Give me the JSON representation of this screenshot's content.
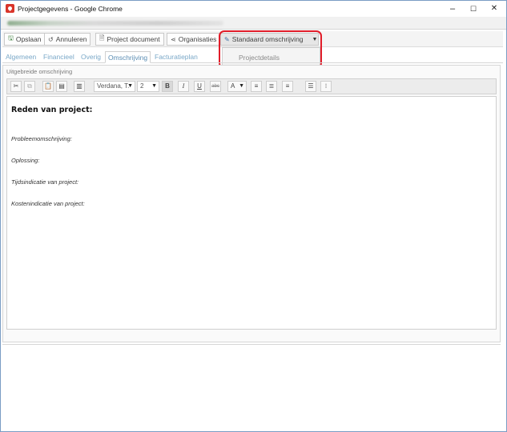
{
  "window": {
    "title": "Projectgegevens - Google Chrome",
    "controls": {
      "minimize": "–",
      "maximize": "☐",
      "close": "✕"
    }
  },
  "toolbar": {
    "save": "Opslaan",
    "cancel": "Annuleren",
    "project_document": "Project document",
    "organisations": "Organisaties",
    "standard_description": "Standaard omschrijving"
  },
  "dropdown": {
    "items": [
      "Projectdetails"
    ]
  },
  "tabs": [
    "Algemeen",
    "Financieel",
    "Overig",
    "Omschrijving",
    "Facturatieplan"
  ],
  "active_tab": "Omschrijving",
  "panel": {
    "caption": "Uitgebreide omschrijving",
    "font": "Verdana, T.",
    "size": "2",
    "format_buttons": {
      "bold": "B",
      "italic": "I",
      "underline": "U",
      "strike": "abc",
      "font_color": "A"
    }
  },
  "editor": {
    "heading": "Reden van project:",
    "lines": [
      "Probleemomschrijving:",
      "Oplossing:",
      "Tijdsindicatie van project:",
      "Kostenindicatie van project:"
    ]
  },
  "colors": {
    "highlight": "#e11d2a",
    "tab_text": "#7aa8c8"
  }
}
